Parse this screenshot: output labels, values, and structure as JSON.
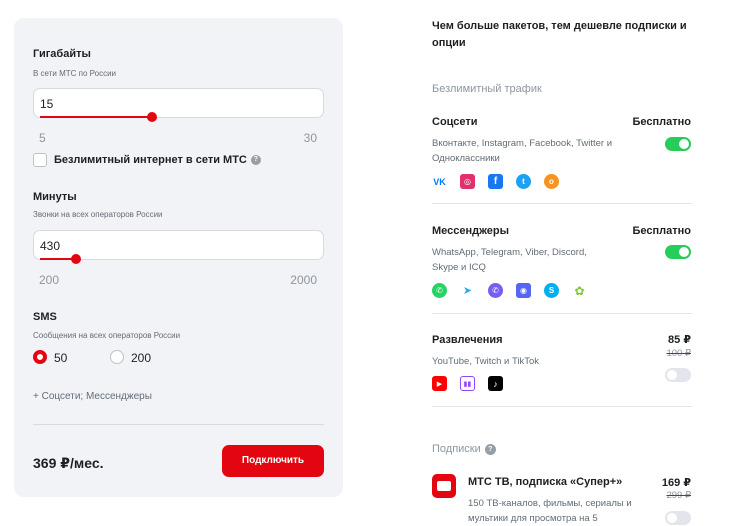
{
  "gigabytes": {
    "title": "Гигабайты",
    "subtitle": "В сети МТС по России",
    "value": "15",
    "min": "5",
    "max": "30",
    "fraction": 0.4,
    "unlimited_label": "Безлимитный интернет в сети МТС"
  },
  "minutes": {
    "title": "Минуты",
    "subtitle": "Звонки на всех операторов России",
    "value": "430",
    "min": "200",
    "max": "2000",
    "fraction": 0.13
  },
  "sms": {
    "title": "SMS",
    "subtitle": "Сообщения на всех операторов России",
    "options": [
      "50",
      "200"
    ],
    "selected": "50"
  },
  "addons_line": "+ Соцсети; Мессенджеры",
  "total_price": "369 ₽/мес.",
  "connect_label": "Подключить",
  "headline": "Чем больше пакетов, тем дешевле подписки и опции",
  "unlimited_traffic_title": "Безлимитный трафик",
  "social": {
    "title": "Соцсети",
    "price": "Бесплатно",
    "desc": "Вконтакте, Instagram, Facebook, Twitter и Одноклассники",
    "enabled": true
  },
  "messengers": {
    "title": "Мессенджеры",
    "price": "Бесплатно",
    "desc": "WhatsApp, Telegram, Viber, Discord, Skype и ICQ",
    "enabled": true
  },
  "entertainment": {
    "title": "Развлечения",
    "price": "85 ₽",
    "old_price": "100 ₽",
    "desc": "YouTube, Twitch и TikTok",
    "enabled": false
  },
  "subscriptions_title": "Подписки",
  "mts_tv": {
    "title": "МТС ТВ, подписка «Супер+»",
    "price": "169 ₽",
    "old_price": "299 ₽",
    "desc": "150 ТВ-каналов, фильмы, сериалы и мультики для просмотра на 5",
    "enabled": false
  },
  "colors": {
    "accent": "#e30611",
    "toggle_on": "#26cd58",
    "card_bg": "#f2f3f7"
  }
}
